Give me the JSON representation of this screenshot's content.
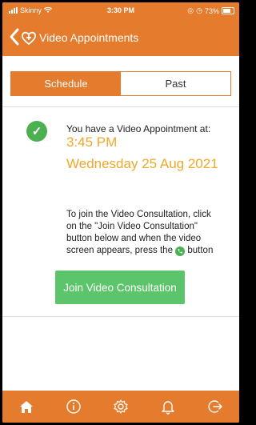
{
  "status_bar": {
    "carrier": "Skinny",
    "time": "3:30 PM",
    "battery": "73%"
  },
  "header": {
    "title": "Video Appointments"
  },
  "tabs": [
    {
      "label": "Schedule",
      "active": true
    },
    {
      "label": "Past",
      "active": false
    }
  ],
  "appointment": {
    "intro": "You have a Video Appointment at:",
    "time": "3:45 PM",
    "date": "Wednesday 25 Aug 2021"
  },
  "instructions": {
    "line1": "To join the Video Consultation, click",
    "line2": "on the \"Join Video Consultation\"",
    "line3": "button below and when the video",
    "line4_before": "screen appears, press the",
    "line4_after": "button"
  },
  "join_button_label": "Join Video Consultation",
  "bottom_nav": [
    "home-icon",
    "info-icon",
    "settings-icon",
    "notifications-icon",
    "logout-icon"
  ],
  "colors": {
    "brand": "#e57b2c",
    "accent": "#f0a82a",
    "success": "#5cc46a"
  }
}
